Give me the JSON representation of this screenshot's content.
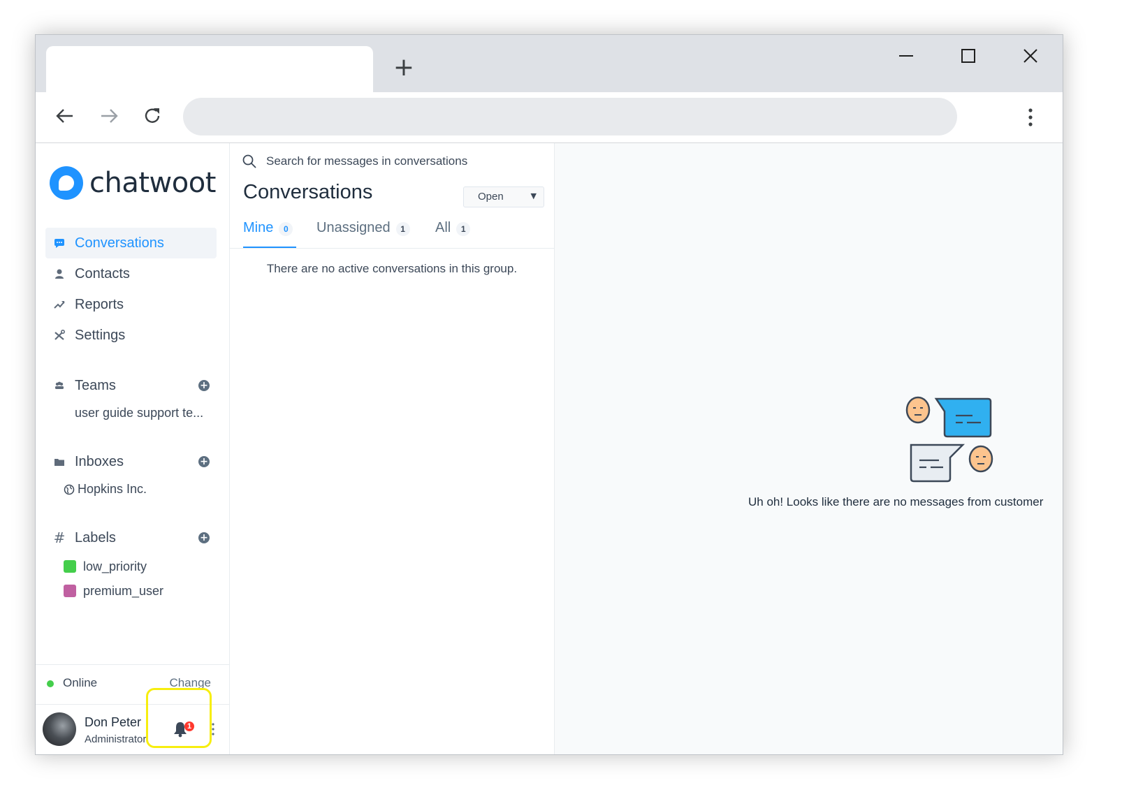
{
  "browser": {
    "new_tab_glyph": "+",
    "address_value": "",
    "address_placeholder": ""
  },
  "brand": {
    "name": "chatwoot",
    "color": "#1f93ff"
  },
  "sidebar": {
    "nav": [
      {
        "label": "Conversations",
        "icon": "chat-icon",
        "active": true
      },
      {
        "label": "Contacts",
        "icon": "person-icon"
      },
      {
        "label": "Reports",
        "icon": "trend-icon"
      },
      {
        "label": "Settings",
        "icon": "tools-icon"
      }
    ],
    "teams": {
      "label": "Teams",
      "items": [
        "user guide support te..."
      ]
    },
    "inboxes": {
      "label": "Inboxes",
      "items": [
        "Hopkins Inc."
      ]
    },
    "labels": {
      "label": "Labels",
      "items": [
        {
          "name": "low_priority",
          "color": "#44ce4b"
        },
        {
          "name": "premium_user",
          "color": "#c060a1"
        }
      ]
    },
    "status": {
      "text": "Online",
      "change_label": "Change",
      "dot_color": "#44ce4b"
    },
    "profile": {
      "name": "Don Peter",
      "role": "Administrator",
      "notification_count": "1"
    }
  },
  "conversations": {
    "search_placeholder": "Search for messages in conversations",
    "title": "Conversations",
    "status_filter": "Open",
    "tabs": [
      {
        "label": "Mine",
        "count": "0",
        "active": true
      },
      {
        "label": "Unassigned",
        "count": "1"
      },
      {
        "label": "All",
        "count": "1"
      }
    ],
    "empty_message": "There are no active conversations in this group."
  },
  "detail": {
    "empty_message": "Uh oh! Looks like there are no messages from customer"
  }
}
